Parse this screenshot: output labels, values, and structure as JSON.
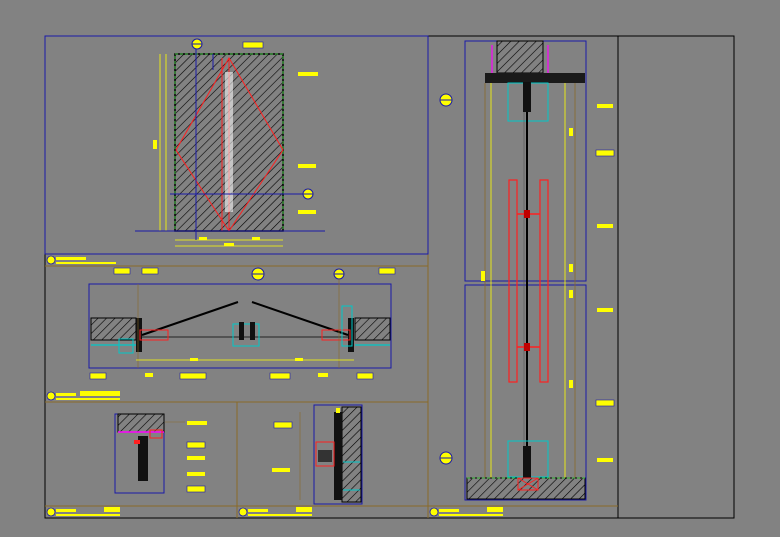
{
  "colors": {
    "background": "#828282",
    "frame": "#000000",
    "border_line": "#8a6a28",
    "view_line": "#1a1aa8",
    "annotation": "#ffff00",
    "cut_line": "#ff1a1a",
    "hatch": "#000000",
    "glass": "#00c8c8",
    "accent": "#ff00ff"
  },
  "icons": [
    "section-marker-icon",
    "dimension-tag-icon",
    "title-bubble-icon",
    "hatch-fill-icon"
  ],
  "views": [
    {
      "id": "door-elevation",
      "label": "",
      "title_text": ""
    },
    {
      "id": "plan-section",
      "label": "",
      "title_text": ""
    },
    {
      "id": "detail-left",
      "label": "",
      "title_text": ""
    },
    {
      "id": "detail-middle",
      "label": "",
      "title_text": ""
    },
    {
      "id": "vertical-section",
      "label": "",
      "title_text": ""
    }
  ]
}
